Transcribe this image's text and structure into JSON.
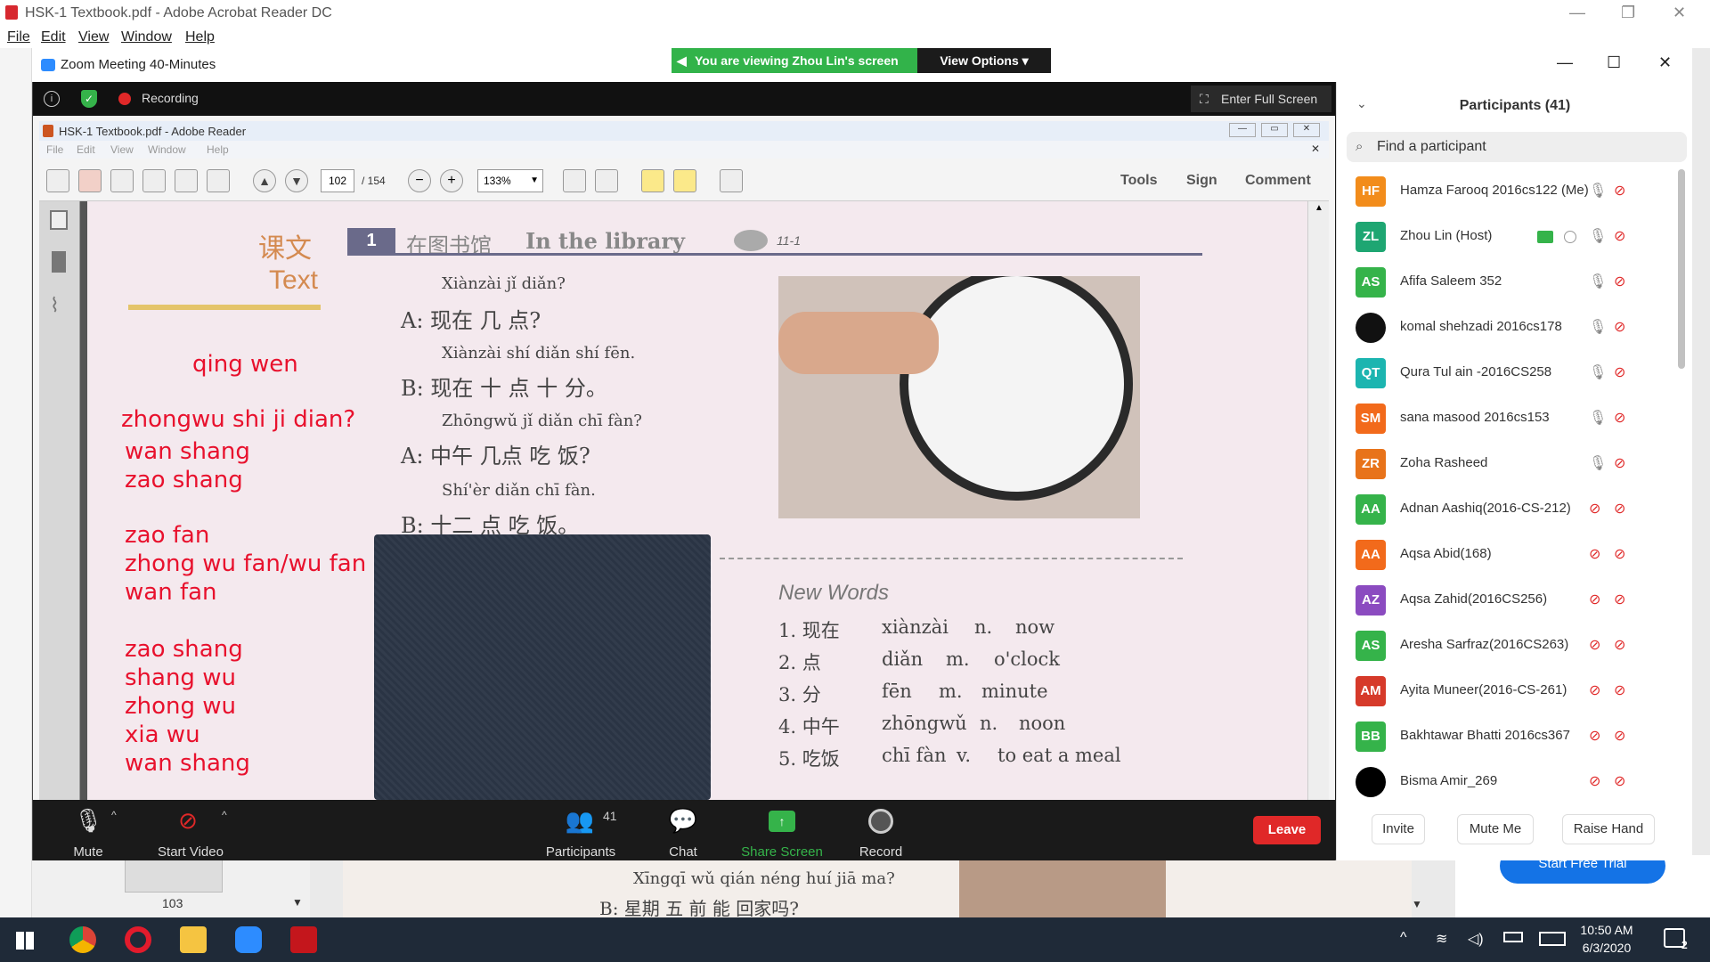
{
  "acrobat": {
    "title": "HSK-1 Textbook.pdf - Adobe Acrobat Reader DC",
    "menu": [
      "File",
      "Edit",
      "View",
      "Window",
      "Help"
    ],
    "thumb_page": "103",
    "cta": "Start Free Trial",
    "bottom_pinyin": "Xīngqī wǔ qián néng huí jiā ma?",
    "bottom_hanzi": "B:  星期 五 前  能  回家吗?"
  },
  "zoom": {
    "title": "Zoom Meeting 40-Minutes",
    "viewing_banner": "You are viewing Zhou Lin's screen",
    "view_options": "View Options",
    "recording": "Recording",
    "enter_full_screen": "Enter Full Screen",
    "toolbar": {
      "mute": "Mute",
      "start_video": "Start Video",
      "participants": "Participants",
      "participants_count": "41",
      "chat": "Chat",
      "share_screen": "Share Screen",
      "record": "Record",
      "leave": "Leave"
    }
  },
  "inner_reader": {
    "title": "HSK-1 Textbook.pdf - Adobe Reader",
    "menu": [
      "File",
      "Edit",
      "View",
      "Window",
      "Help"
    ],
    "page_current": "102",
    "page_total": "/ 154",
    "zoom_level": "133%",
    "tools": "Tools",
    "sign": "Sign",
    "comment": "Comment"
  },
  "page": {
    "lesson_cn": "课文",
    "lesson_en": "Text",
    "section_num": "1",
    "section_cn": "在图书馆",
    "section_en": "In the library",
    "track": "11-1",
    "dialogue": [
      {
        "pinyin": "Xiànzài jǐ diǎn?",
        "line": "A:  现在 几 点?"
      },
      {
        "pinyin": "Xiànzài shí diǎn shí fēn.",
        "line": "B:  现在  十 点  十 分。"
      },
      {
        "pinyin": "Zhōngwǔ jǐ diǎn chī fàn?",
        "line": "A:  中午    几点  吃 饭?"
      },
      {
        "pinyin": "Shí'èr diǎn chī fàn.",
        "line": "B:  十二  点  吃 饭。"
      }
    ],
    "notes": [
      "qing wen",
      "zhongwu shi ji dian?",
      "wan shang",
      "zao shang",
      "zao fan",
      "zhong wu fan/wu fan",
      "wan fan",
      "zao shang",
      "shang wu",
      "zhong wu",
      "xia wu",
      "wan shang"
    ],
    "new_words_title": "New Words",
    "new_words": [
      {
        "n": "1. 现在",
        "py": "xiànzài",
        "pos": "n.",
        "en": "now"
      },
      {
        "n": "2. 点",
        "py": "diǎn",
        "pos": "m.",
        "en": "o'clock"
      },
      {
        "n": "3. 分",
        "py": "fēn",
        "pos": "m.",
        "en": "minute"
      },
      {
        "n": "4. 中午",
        "py": "zhōngwǔ",
        "pos": "n.",
        "en": "noon"
      },
      {
        "n": "5. 吃饭",
        "py": "chī fàn",
        "pos": "v.",
        "en": "to eat a meal"
      }
    ]
  },
  "participants_panel": {
    "title": "Participants (41)",
    "search_placeholder": "Find a participant",
    "list": [
      {
        "initials": "HF",
        "name": "Hamza Farooq 2016cs122 (Me)",
        "color": "#f28c1b"
      },
      {
        "initials": "ZL",
        "name": "Zhou Lin (Host)",
        "color": "#1ea672"
      },
      {
        "initials": "AS",
        "name": "Afifa Saleem 352",
        "color": "#35b34a"
      },
      {
        "initials": "",
        "name": "komal shehzadi 2016cs178",
        "color": "#111111"
      },
      {
        "initials": "QT",
        "name": "Qura Tul ain -2016CS258",
        "color": "#1cb5b0"
      },
      {
        "initials": "SM",
        "name": "sana masood 2016cs153",
        "color": "#f26a1b"
      },
      {
        "initials": "ZR",
        "name": "Zoha Rasheed",
        "color": "#e8731a"
      },
      {
        "initials": "AA",
        "name": "Adnan Aashiq(2016-CS-212)",
        "color": "#35b34a"
      },
      {
        "initials": "AA",
        "name": "Aqsa Abid(168)",
        "color": "#f26a1b"
      },
      {
        "initials": "AZ",
        "name": "Aqsa Zahid(2016CS256)",
        "color": "#8b4bc0"
      },
      {
        "initials": "AS",
        "name": "Aresha Sarfraz(2016CS263)",
        "color": "#35b34a"
      },
      {
        "initials": "AM",
        "name": "Ayita Muneer(2016-CS-261)",
        "color": "#d63a2a"
      },
      {
        "initials": "BB",
        "name": "Bakhtawar Bhatti 2016cs367",
        "color": "#35b34a"
      },
      {
        "initials": "",
        "name": "Bisma Amir_269",
        "color": "#000000"
      }
    ],
    "invite": "Invite",
    "mute_me": "Mute Me",
    "raise_hand": "Raise Hand"
  },
  "taskbar": {
    "time": "10:50 AM",
    "date": "6/3/2020",
    "notif_count": "2"
  }
}
